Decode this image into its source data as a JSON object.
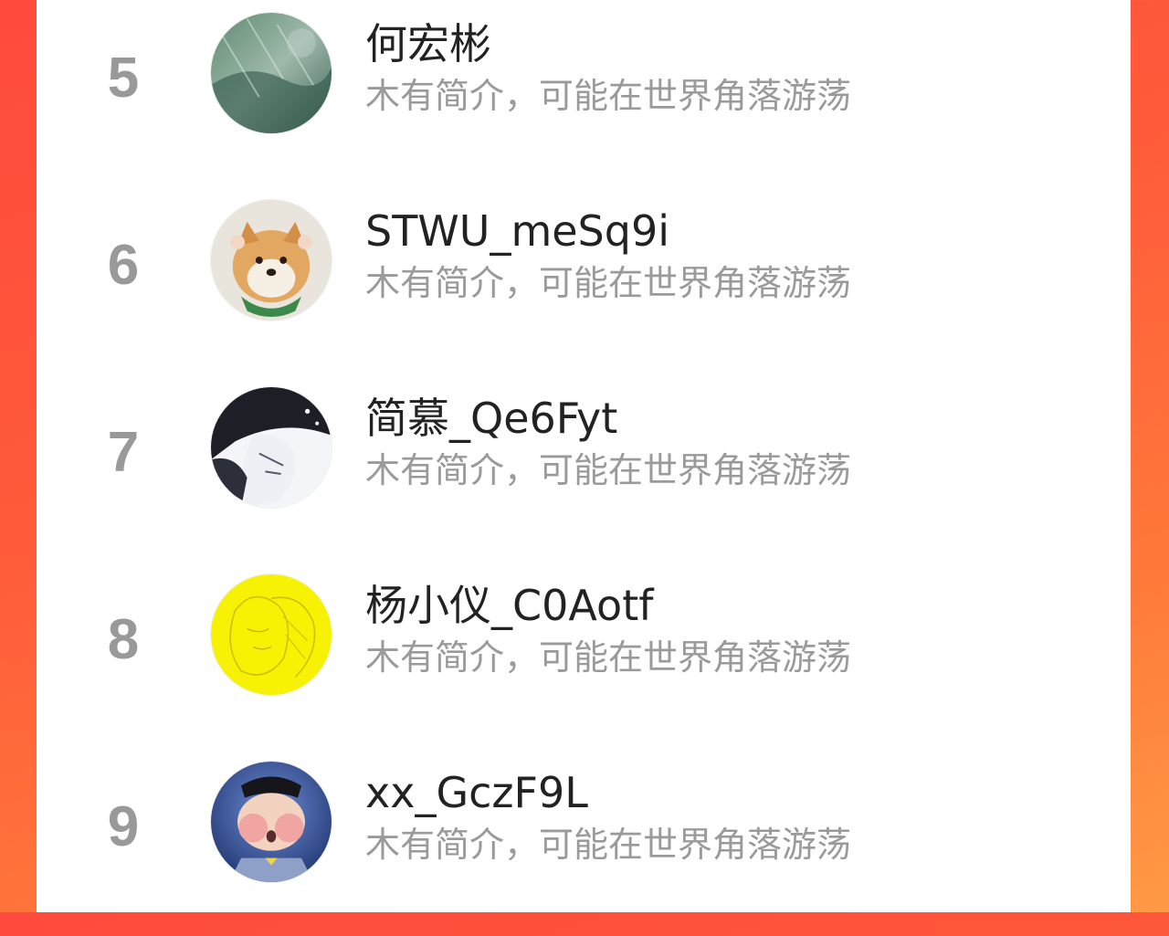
{
  "colors": {
    "background_gradient_start": "#ff4a3d",
    "background_gradient_end": "#ff9a45",
    "panel": "#ffffff",
    "rank_text": "#999999",
    "name_text": "#222222",
    "bio_text": "#9a9a9a"
  },
  "ranking": {
    "items": [
      {
        "rank": "5",
        "name": "何宏彬",
        "bio": "木有简介，可能在世界角落游荡",
        "avatar": "misty-green-painting-avatar"
      },
      {
        "rank": "6",
        "name": "STWU_meSq9i",
        "bio": "木有简介，可能在世界角落游荡",
        "avatar": "shiba-dog-avatar"
      },
      {
        "rank": "7",
        "name": "简慕_Qe6Fyt",
        "bio": "木有简介，可能在世界角落游荡",
        "avatar": "anime-boy-dark-avatar"
      },
      {
        "rank": "8",
        "name": "杨小仪_C0Aotf",
        "bio": "木有简介，可能在世界角落游荡",
        "avatar": "yellow-sketch-avatar"
      },
      {
        "rank": "9",
        "name": "xx_GczF9L",
        "bio": "木有简介，可能在世界角落游荡",
        "avatar": "cartoon-kid-avatar"
      }
    ]
  }
}
